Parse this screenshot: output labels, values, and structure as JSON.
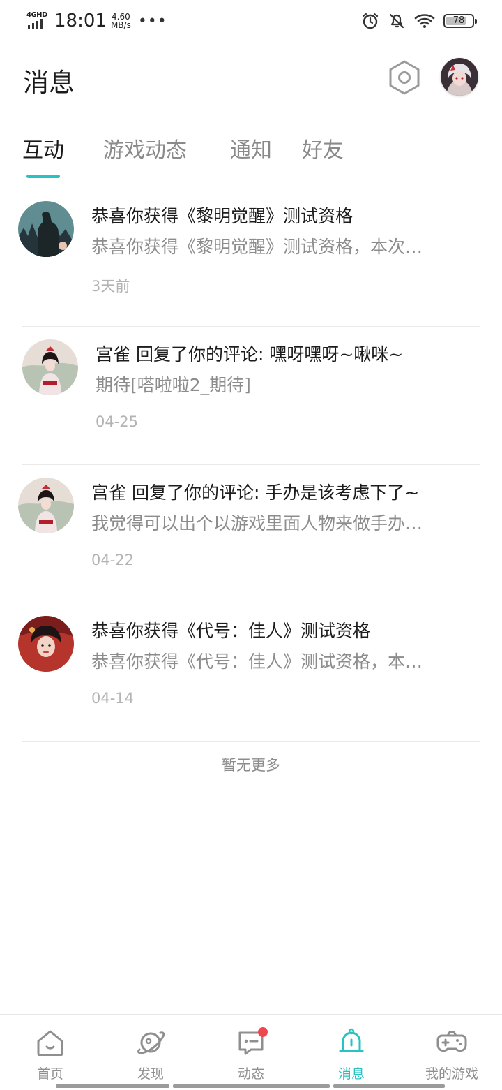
{
  "status_bar": {
    "network": "4GHD",
    "time": "18:01",
    "speed_value": "4.60",
    "speed_unit": "MB/s",
    "more": "•••",
    "battery": "78",
    "battery_level": 0.78
  },
  "header": {
    "title": "消息"
  },
  "tabs": [
    {
      "label": "互动",
      "active": true
    },
    {
      "label": "游戏动态",
      "active": false
    },
    {
      "label": "通知",
      "active": false
    },
    {
      "label": "好友",
      "active": false
    }
  ],
  "messages": [
    {
      "title": "恭喜你获得《黎明觉醒》测试资格",
      "preview": "恭喜你获得《黎明觉醒》测试资格，本次…",
      "time": "3天前"
    },
    {
      "title": "宫雀 回复了你的评论: 嘿呀嘿呀~啾咪~",
      "preview": "期待[嗒啦啦2_期待]",
      "time": "04-25"
    },
    {
      "title": "宫雀 回复了你的评论: 手办是该考虑下了~",
      "preview": "我觉得可以出个以游戏里面人物来做手办…",
      "time": "04-22"
    },
    {
      "title": "恭喜你获得《代号：佳人》测试资格",
      "preview": "恭喜你获得《代号：佳人》测试资格，本…",
      "time": "04-14"
    }
  ],
  "footer_note": "暂无更多",
  "bottom_nav": [
    {
      "label": "首页",
      "icon": "home-icon",
      "active": false
    },
    {
      "label": "发现",
      "icon": "planet-icon",
      "active": false
    },
    {
      "label": "动态",
      "icon": "chat-icon",
      "active": false,
      "badge": true
    },
    {
      "label": "消息",
      "icon": "bell-icon",
      "active": true
    },
    {
      "label": "我的游戏",
      "icon": "gamepad-icon",
      "active": false
    }
  ],
  "colors": {
    "accent": "#28c2c3",
    "badge": "#f0474e",
    "text_primary": "#1c1c1c",
    "text_secondary": "#8c8c8c"
  }
}
